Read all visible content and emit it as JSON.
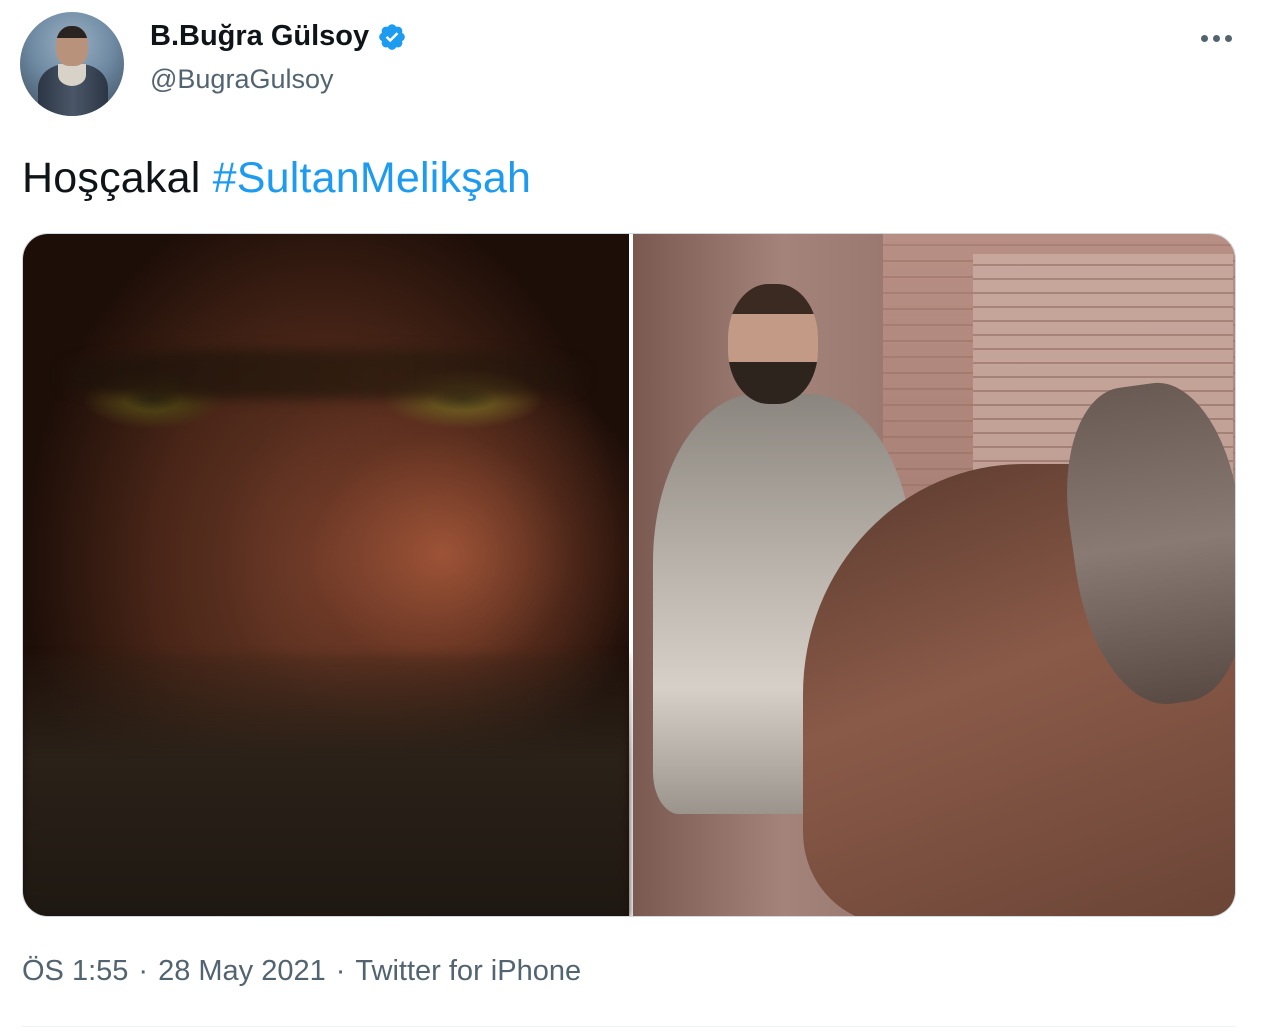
{
  "user": {
    "display_name": "B.Buğra Gülsoy",
    "handle": "@BugraGulsoy",
    "verified": true,
    "verified_color": "#1d9bf0"
  },
  "menu": {
    "icon": "more-icon"
  },
  "tweet": {
    "text_plain": "Hoşçakal",
    "hashtag": "#SultanMelikşah",
    "hashtag_color": "#1d9bf0"
  },
  "media": {
    "count": 2
  },
  "footer": {
    "time": "ÖS 1:55",
    "separator": "·",
    "date": "28 May 2021",
    "source": "Twitter for iPhone"
  }
}
